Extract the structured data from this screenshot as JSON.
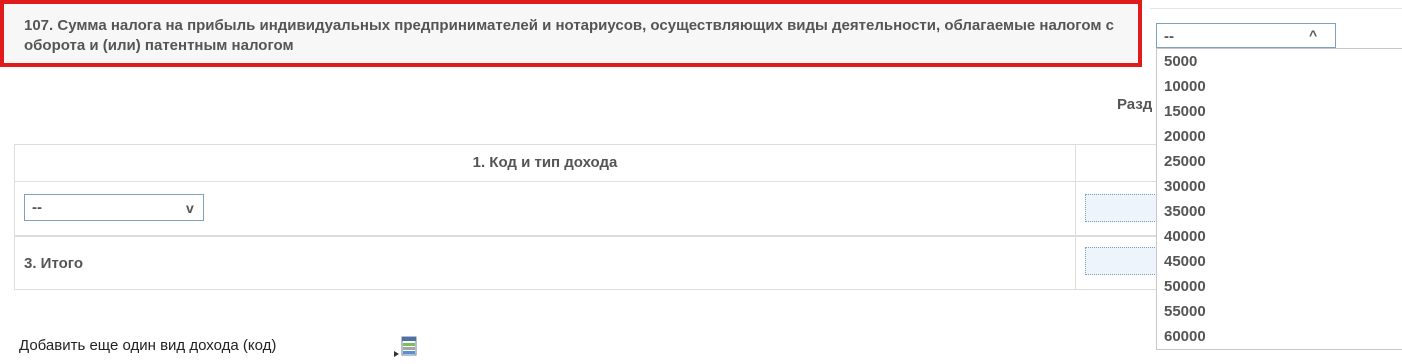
{
  "question": {
    "text": "107. Сумма налога на прибыль индивидуальных предпринимателей и нотариусов, осуществляющих виды деятельности, облагаемые налогом с оборота и (или) патентным налогом"
  },
  "amount_select": {
    "selected": "--",
    "arrow": "^",
    "options": [
      "5000",
      "10000",
      "15000",
      "20000",
      "25000",
      "30000",
      "35000",
      "40000",
      "45000",
      "50000",
      "55000",
      "60000"
    ]
  },
  "section_label": "Разд",
  "income_table": {
    "header_col1": "1. Код и тип дохода",
    "row1_select": {
      "value": "--",
      "arrow": "v"
    },
    "total_label": "3. Итого"
  },
  "add_income": {
    "label": "Добавить еще один вид дохода (код)",
    "icon": "add-row-icon"
  },
  "colors": {
    "highlight_border": "#e01b1b",
    "input_border": "#7fa1bf",
    "text": "#555555"
  }
}
